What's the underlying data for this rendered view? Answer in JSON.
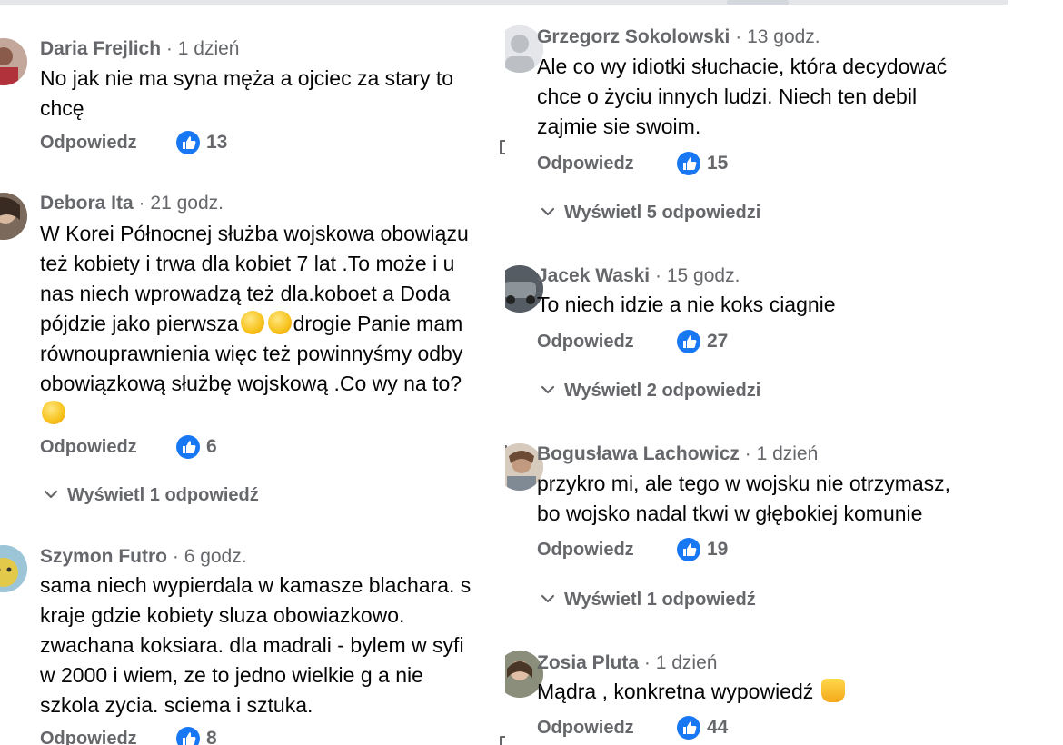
{
  "common": {
    "reply_label": "Odpowiedz",
    "sep": "·"
  },
  "left": [
    {
      "author": "Daria Frejlich",
      "time": "1 dzień",
      "text": "No jak nie ma syna męża a ojciec za stary to\nchcę",
      "likes": "13"
    },
    {
      "author": "Debora Ita",
      "time": "21 godz.",
      "text_lines": [
        "W Korei Północnej służba wojskowa obowiązu",
        "też kobiety i trwa dla kobiet 7 lat .To może i u",
        "nas niech wprowadzą też dla.koboet a Doda"
      ],
      "line4_a": "pójdzie jako pierwsza",
      "line4_b": "drogie Panie mam",
      "line5": "równouprawnienia więc też powinnyśmy odby",
      "line6": "obowiązkową służbę wojskową .Co wy na to?",
      "likes": "6",
      "view_replies": "Wyświetl 1 odpowiedź"
    },
    {
      "author": "Szymon Futro",
      "time": "6 godz.",
      "text": "sama niech wypierdala w kamasze blachara. s\nkraje gdzie kobiety sluza obowiazkowo.\nzwachana koksiara. dla madrali - bylem w syfi\nw 2000 i wiem, ze to jedno wielkie g a nie\nszkola zycia. sciema i sztuka.",
      "likes": "8"
    }
  ],
  "right": [
    {
      "author": "Grzegorz Sokolowski",
      "time": "13 godz.",
      "text": "Ale co wy idiotki słuchacie, która decydować\nchce o życiu innych ludzi. Niech ten debil\nzajmie sie swoim.",
      "likes": "15",
      "view_replies": "Wyświetl 5 odpowiedzi"
    },
    {
      "author": "Jacek Waski",
      "time": "15 godz.",
      "text": "To niech idzie a nie koks ciagnie",
      "likes": "27",
      "view_replies": "Wyświetl 2 odpowiedzi"
    },
    {
      "author": "Bogusława Lachowicz",
      "time": "1 dzień",
      "text": "przykro mi, ale tego w wojsku nie otrzymasz,\nbo wojsko nadal tkwi w głębokiej komunie",
      "likes": "19",
      "view_replies": "Wyświetl 1 odpowiedź"
    },
    {
      "author": "Zosia Pluta",
      "time": "1 dzień",
      "text": "Mądra , konkretna wypowiedź ",
      "likes": "44"
    }
  ],
  "colors": {
    "like_blue": "#1877f2",
    "meta_gray": "#65676b",
    "text": "#050505"
  }
}
